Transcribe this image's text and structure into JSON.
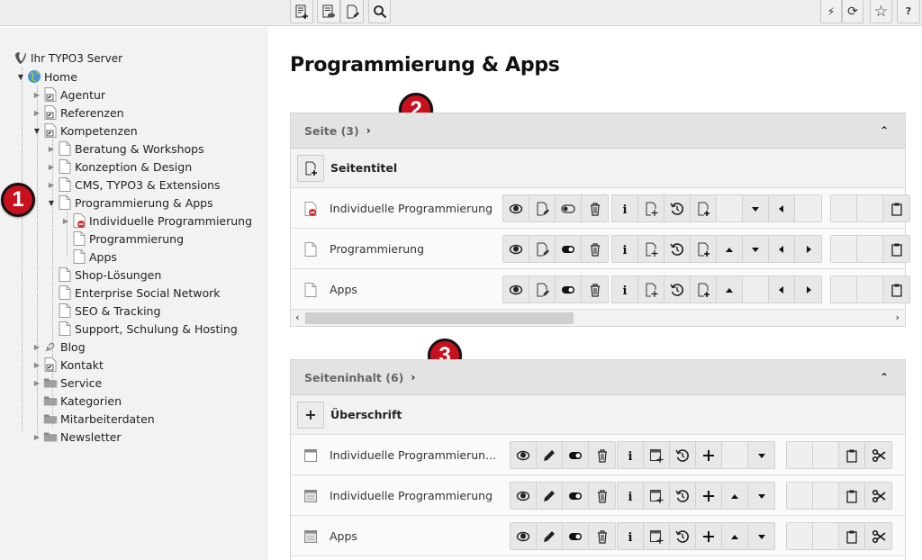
{
  "toolbar": {
    "left_buttons": [
      {
        "icon": "new-record-icon",
        "title": "New record"
      },
      {
        "icon": "view-page-icon",
        "title": "View page"
      },
      {
        "icon": "edit-page-icon",
        "title": "Edit page properties"
      },
      {
        "icon": "search-icon",
        "title": "Search"
      }
    ],
    "right_buttons": [
      {
        "icon": "flash-icon",
        "label": "⚡"
      },
      {
        "icon": "refresh-icon",
        "label": "⟳"
      },
      {
        "icon": "star-icon",
        "label": "☆"
      },
      {
        "icon": "help-icon",
        "label": "?"
      }
    ]
  },
  "tree": {
    "root": "Ihr TYPO3 Server",
    "nodes": [
      {
        "label": "Home",
        "level": 1,
        "expanded": true,
        "icon": "globe"
      },
      {
        "label": "Agentur",
        "level": 2,
        "expanded": false,
        "icon": "shortcut"
      },
      {
        "label": "Referenzen",
        "level": 2,
        "expanded": false,
        "icon": "shortcut"
      },
      {
        "label": "Kompetenzen",
        "level": 2,
        "expanded": true,
        "icon": "shortcut"
      },
      {
        "label": "Beratung & Workshops",
        "level": 3,
        "expanded": false,
        "icon": "page"
      },
      {
        "label": "Konzeption & Design",
        "level": 3,
        "expanded": false,
        "icon": "page"
      },
      {
        "label": "CMS, TYPO3 & Extensions",
        "level": 3,
        "expanded": false,
        "icon": "page"
      },
      {
        "label": "Programmierung & Apps",
        "level": 3,
        "expanded": true,
        "icon": "page"
      },
      {
        "label": "Individuelle Programmierung",
        "level": 4,
        "expanded": false,
        "icon": "page-hidden"
      },
      {
        "label": "Programmierung",
        "level": 4,
        "expanded": null,
        "icon": "page"
      },
      {
        "label": "Apps",
        "level": 4,
        "expanded": null,
        "icon": "page"
      },
      {
        "label": "Shop-Lösungen",
        "level": 3,
        "expanded": null,
        "icon": "page"
      },
      {
        "label": "Enterprise Social Network",
        "level": 3,
        "expanded": null,
        "icon": "page"
      },
      {
        "label": "SEO & Tracking",
        "level": 3,
        "expanded": null,
        "icon": "page"
      },
      {
        "label": "Support, Schulung & Hosting",
        "level": 3,
        "expanded": null,
        "icon": "page"
      },
      {
        "label": "Blog",
        "level": 2,
        "expanded": false,
        "icon": "link"
      },
      {
        "label": "Kontakt",
        "level": 2,
        "expanded": false,
        "icon": "shortcut"
      },
      {
        "label": "Service",
        "level": 2,
        "expanded": false,
        "icon": "folder"
      },
      {
        "label": "Kategorien",
        "level": 2,
        "expanded": null,
        "icon": "folder"
      },
      {
        "label": "Mitarbeiterdaten",
        "level": 2,
        "expanded": null,
        "icon": "folder"
      },
      {
        "label": "Newsletter",
        "level": 2,
        "expanded": false,
        "icon": "folder"
      }
    ]
  },
  "annotations": [
    "1",
    "2",
    "3"
  ],
  "main": {
    "title": "Programmierung & Apps",
    "pages_panel": {
      "title": "Seite (3)",
      "new_label": "Seitentitel",
      "rows": [
        {
          "label": "Individuelle Programmierung",
          "icon": "page-hidden",
          "visible": false,
          "move": [
            "",
            "down",
            "left",
            ""
          ]
        },
        {
          "label": "Programmierung",
          "icon": "page",
          "visible": true,
          "move": [
            "up",
            "down",
            "left",
            "right"
          ]
        },
        {
          "label": "Apps",
          "icon": "page",
          "visible": true,
          "move": [
            "up",
            "",
            "left",
            "right"
          ]
        }
      ]
    },
    "content_panel": {
      "title": "Seiteninhalt (6)",
      "new_label": "Überschrift",
      "rows": [
        {
          "label": "Individuelle Programmierun...",
          "move": [
            "",
            "down"
          ]
        },
        {
          "label": "Individuelle Programmierung",
          "move": [
            "up",
            "down"
          ]
        },
        {
          "label": "Apps",
          "move": [
            "up",
            "down"
          ]
        }
      ]
    }
  }
}
